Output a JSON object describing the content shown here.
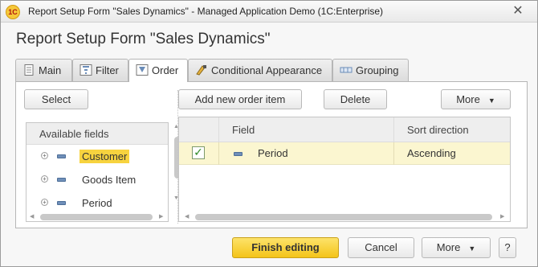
{
  "window": {
    "title": "Report Setup Form \"Sales Dynamics\" - Managed Application Demo  (1C:Enterprise)",
    "logo_text": "1C",
    "close_glyph": "✕"
  },
  "form": {
    "title": "Report Setup Form \"Sales Dynamics\""
  },
  "tabs": [
    {
      "label": "Main",
      "icon": "document-icon"
    },
    {
      "label": "Filter",
      "icon": "filter-icon"
    },
    {
      "label": "Order",
      "icon": "sort-icon"
    },
    {
      "label": "Conditional Appearance",
      "icon": "paint-icon"
    },
    {
      "label": "Grouping",
      "icon": "grouping-icon"
    }
  ],
  "active_tab": "Order",
  "left_panel": {
    "select_label": "Select",
    "header": "Available fields",
    "items": [
      {
        "label": "Customer",
        "selected": true
      },
      {
        "label": "Goods Item",
        "selected": false
      },
      {
        "label": "Period",
        "selected": false
      }
    ]
  },
  "right_panel": {
    "add_label": "Add new order item",
    "delete_label": "Delete",
    "more_label": "More",
    "columns": {
      "field": "Field",
      "direction": "Sort direction"
    },
    "rows": [
      {
        "checked": true,
        "field": "Period",
        "direction": "Ascending"
      }
    ]
  },
  "footer": {
    "finish_label": "Finish editing",
    "cancel_label": "Cancel",
    "more_label": "More",
    "help_label": "?"
  },
  "colors": {
    "accent_yellow": "#f4c419",
    "selection": "#f7d33f",
    "row_highlight": "#fbf6d0"
  }
}
